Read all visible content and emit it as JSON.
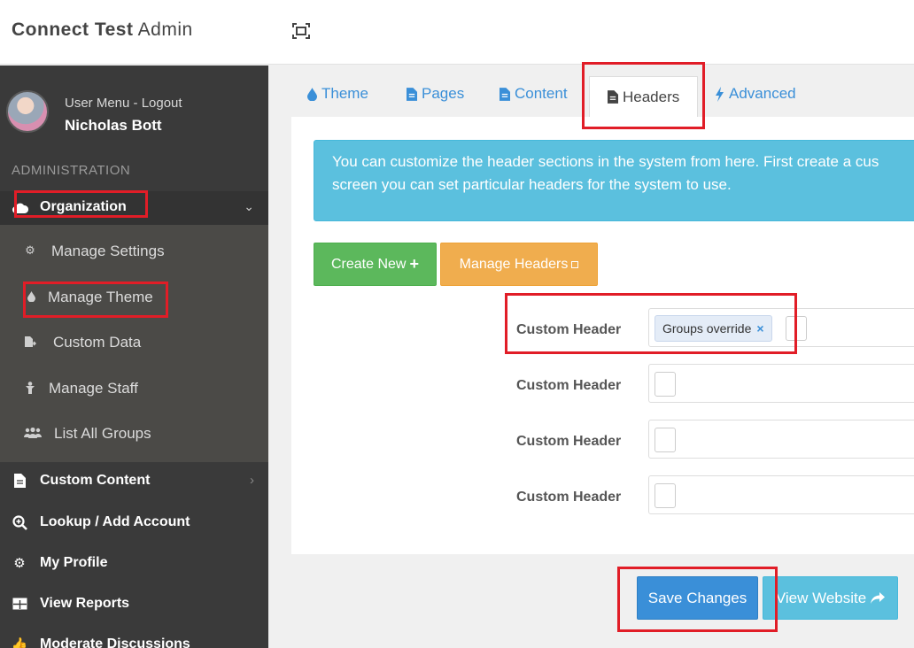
{
  "app": {
    "brand_bold": "Connect Test",
    "brand_light": "Admin"
  },
  "user": {
    "menu_link": "User Menu - Logout",
    "name": "Nicholas Bott"
  },
  "sidebar": {
    "section_label": "ADMINISTRATION",
    "organization": {
      "label": "Organization"
    },
    "submenu": [
      {
        "label": "Manage Settings",
        "icon": "gear-icon"
      },
      {
        "label": "Manage Theme",
        "icon": "droplet-icon"
      },
      {
        "label": "Custom Data",
        "icon": "file-export-icon"
      },
      {
        "label": "Manage Staff",
        "icon": "person-icon"
      },
      {
        "label": "List All Groups",
        "icon": "users-icon"
      }
    ],
    "items": [
      {
        "label": "Custom Content",
        "icon": "file-icon"
      },
      {
        "label": "Lookup / Add Account",
        "icon": "search-plus-icon"
      },
      {
        "label": "My Profile",
        "icon": "gear-icon"
      },
      {
        "label": "View Reports",
        "icon": "table-icon"
      },
      {
        "label": "Moderate Discussions",
        "icon": "thumbs-up-icon"
      }
    ]
  },
  "tabs": [
    {
      "label": "Theme",
      "icon": "droplet-icon"
    },
    {
      "label": "Pages",
      "icon": "file-icon"
    },
    {
      "label": "Content",
      "icon": "file-icon"
    },
    {
      "label": "Headers",
      "icon": "file-icon"
    },
    {
      "label": "Advanced",
      "icon": "bolt-icon"
    }
  ],
  "info_text_line1": "You can customize the header sections in the system from here. First create a cus",
  "info_text_line2": "screen you can set particular headers for the system to use.",
  "buttons": {
    "create_new": "Create New",
    "manage_headers": "Manage Headers",
    "save": "Save Changes",
    "view_website": "View Website"
  },
  "fields": [
    {
      "label": "Custom Header",
      "chip": "Groups override"
    },
    {
      "label": "Custom Header"
    },
    {
      "label": "Custom Header"
    },
    {
      "label": "Custom Header"
    }
  ],
  "colors": {
    "primary": "#3a8fd8",
    "success": "#5cb85c",
    "warning": "#f0ad4e",
    "info": "#5bc0de",
    "annotation": "#e11d27",
    "sidebar": "#3a3a3a"
  }
}
